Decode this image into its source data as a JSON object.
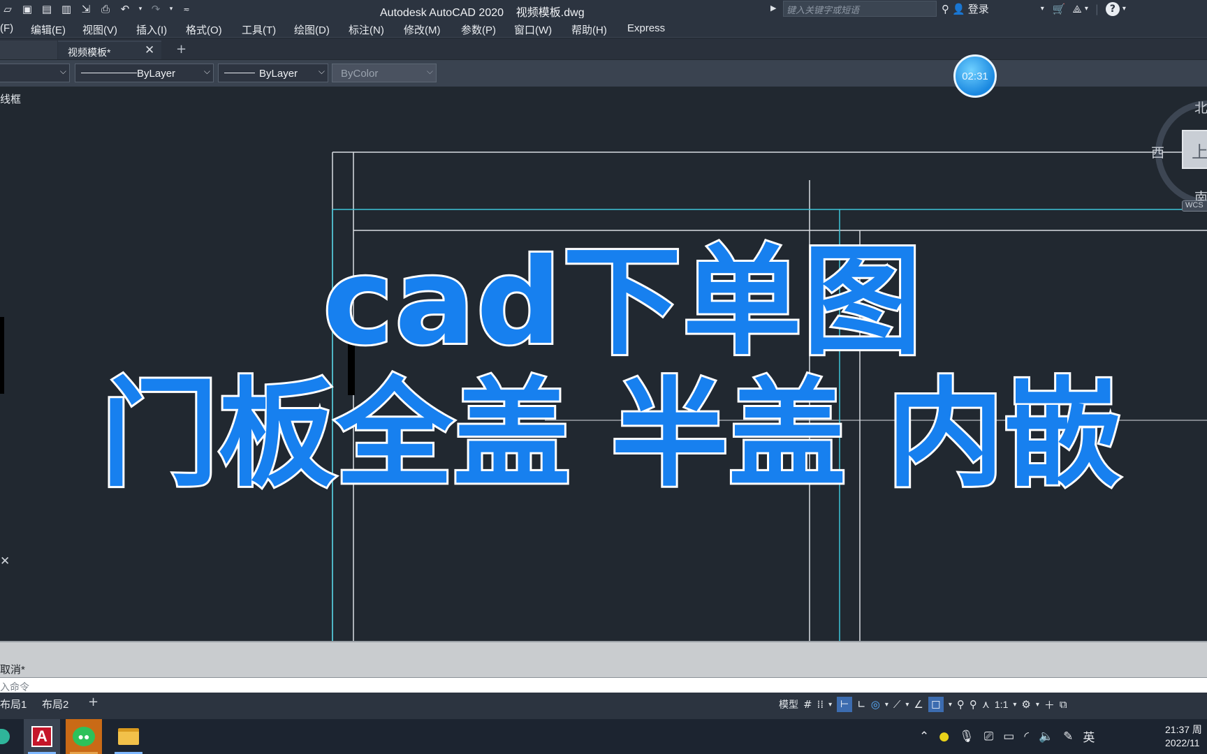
{
  "app": {
    "title": "Autodesk AutoCAD 2020    视频模板.dwg",
    "search_placeholder": "键入关键字或短语",
    "login_label": "登录"
  },
  "menu": [
    "(F)",
    "编辑(E)",
    "视图(V)",
    "插入(I)",
    "格式(O)",
    "工具(T)",
    "绘图(D)",
    "标注(N)",
    "修改(M)",
    "参数(P)",
    "窗口(W)",
    "帮助(H)",
    "Express"
  ],
  "tabs": {
    "active": "视频模板*",
    "close_glyph": "✕",
    "add_glyph": "+"
  },
  "properties": {
    "linetype": "ByLayer",
    "lineweight": "ByLayer",
    "plotstyle": "ByColor"
  },
  "canvas": {
    "viewport_label": "线框",
    "timer": "02:31",
    "viewcube": {
      "north": "北",
      "west": "西",
      "south": "南",
      "face": "上",
      "wcs": "WCS"
    },
    "overlay_line1": "cad下单图",
    "overlay_line2": "门板全盖 半盖 内嵌"
  },
  "command": {
    "history": "取消*",
    "placeholder": "入命令"
  },
  "layout_tabs": [
    "布局1",
    "布局2"
  ],
  "status": {
    "model": "模型",
    "scale": "1:1"
  },
  "taskbar": {
    "ime": "英",
    "time": "21:37 周",
    "date": "2022/11"
  },
  "colors": {
    "accent": "#1780ef",
    "cyan_line": "#3ec6d8",
    "white_line": "#d9dde2",
    "canvas_bg": "#212830"
  }
}
